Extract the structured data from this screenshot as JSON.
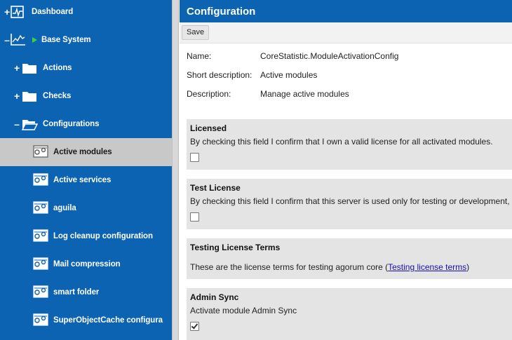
{
  "sidebar": {
    "items": [
      {
        "label": "Dashboard",
        "toggle": "+",
        "icon": "dashboard-icon"
      },
      {
        "label": "Base System",
        "toggle": "–",
        "icon": "chart-icon"
      },
      {
        "label": "Actions",
        "toggle": "+",
        "icon": "folder-icon"
      },
      {
        "label": "Checks",
        "toggle": "+",
        "icon": "folder-icon"
      },
      {
        "label": "Configurations",
        "toggle": "–",
        "icon": "folder-open-icon"
      },
      {
        "label": "Active modules",
        "icon": "config-icon",
        "selected": true
      },
      {
        "label": "Active services",
        "icon": "config-icon"
      },
      {
        "label": "aguila",
        "icon": "config-icon"
      },
      {
        "label": "Log cleanup configuration",
        "icon": "config-icon"
      },
      {
        "label": "Mail compression",
        "icon": "config-icon"
      },
      {
        "label": "smart folder",
        "icon": "config-icon"
      },
      {
        "label": "SuperObjectCache configura",
        "icon": "config-icon"
      }
    ]
  },
  "main": {
    "title": "Configuration",
    "save_label": "Save",
    "meta": {
      "name_label": "Name:",
      "name_value": "CoreStatistic.ModuleActivationConfig",
      "short_label": "Short description:",
      "short_value": "Active modules",
      "desc_label": "Description:",
      "desc_value": "Manage active modules"
    },
    "panels": {
      "licensed": {
        "title": "Licensed",
        "text": "By checking this field I confirm that I own a valid license for all activated modules.",
        "checked": false
      },
      "test_license": {
        "title": "Test License",
        "text": "By checking this field I confirm that this server is used only for testing or development,",
        "checked": false
      },
      "testing_terms": {
        "title": "Testing License Terms",
        "text_before": "These are the license terms for testing agorum core (",
        "link": "Testing license terms",
        "text_after": ")"
      },
      "admin_sync": {
        "title": "Admin Sync",
        "text": "Activate module Admin Sync",
        "checked": true
      }
    }
  },
  "colors": {
    "sidebar_bg": "#0b63b2",
    "selected_bg": "#c8c8c8",
    "panel_bg": "#e4e4e4",
    "accent_green": "#3fd13f"
  }
}
